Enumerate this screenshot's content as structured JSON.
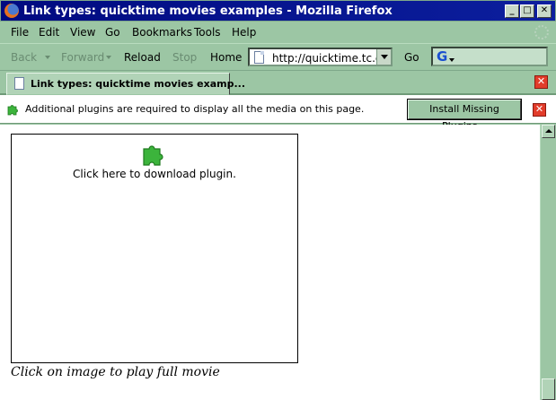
{
  "window": {
    "title": "Link types: quicktime movies examples - Mozilla Firefox",
    "minimize": "_",
    "maximize": "□",
    "close": "✕"
  },
  "menu": [
    "File",
    "Edit",
    "View",
    "Go",
    "Bookmarks",
    "Tools",
    "Help"
  ],
  "toolbar": {
    "back": "Back",
    "forward": "Forward",
    "reload": "Reload",
    "stop": "Stop",
    "home": "Home",
    "url": "http://quicktime.tc.cc",
    "go": "Go",
    "search_icon": "G"
  },
  "tab": {
    "label": "Link types: quicktime movies examp...",
    "close": "✕"
  },
  "notification": {
    "message": "Additional plugins are required to display all the media on this page.",
    "install_button": "Install Missing Plugins...",
    "close": "✕"
  },
  "content": {
    "plugin_text": "Click here to download plugin.",
    "caption": "Click on image to play full movie"
  },
  "colors": {
    "chrome": "#9cc6a4",
    "titlebar": "#000a80",
    "close_red": "#e23c2a",
    "plugin_green": "#3cb43c"
  },
  "icons": {
    "browser": "firefox-icon",
    "page": "page-icon",
    "plugin": "puzzle-piece-icon",
    "throbber": "throbber-icon"
  }
}
